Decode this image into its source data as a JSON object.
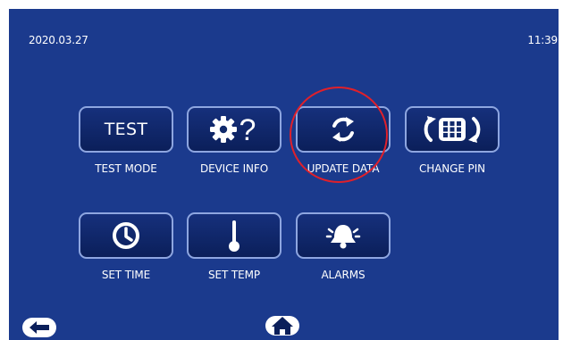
{
  "status": {
    "date": "2020.03.27",
    "time": "11:39"
  },
  "tiles": [
    {
      "label": "TEST MODE",
      "button_text": "TEST"
    },
    {
      "label": "DEVICE INFO",
      "icon": "gear-question-icon"
    },
    {
      "label": "UPDATE DATA",
      "icon": "refresh-icon"
    },
    {
      "label": "CHANGE PIN",
      "icon": "keypad-icon"
    },
    {
      "label": "SET TIME",
      "icon": "clock-icon"
    },
    {
      "label": "SET TEMP",
      "icon": "thermometer-icon"
    },
    {
      "label": "ALARMS",
      "icon": "alarm-bell-icon"
    }
  ],
  "nav": {
    "back_icon": "back-arrow-icon",
    "home_icon": "home-icon"
  },
  "colors": {
    "background": "#1b3a8d",
    "tile_border": "#8ea6e0",
    "highlight": "#e0202a"
  }
}
